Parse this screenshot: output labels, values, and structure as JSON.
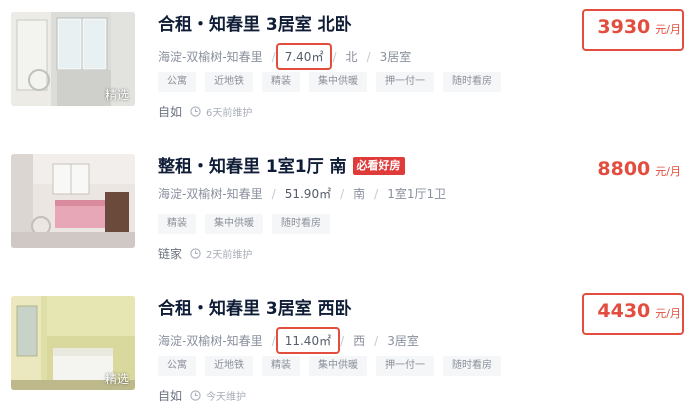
{
  "listings": [
    {
      "title": "合租・知春里 3居室 北卧",
      "promo_badge": "",
      "thumb_badge": "精选",
      "location": "海淀-双榆树-知春里",
      "area": "7.40㎡",
      "orientation": "北",
      "layout": "3居室",
      "tags": [
        "公寓",
        "近地铁",
        "精装",
        "集中供暖",
        "押一付一",
        "随时看房"
      ],
      "brand": "自如",
      "updated": "6天前维护",
      "price": "3930",
      "price_unit": "元/月"
    },
    {
      "title": "整租・知春里 1室1厅 南",
      "promo_badge": "必看好房",
      "thumb_badge": "",
      "location": "海淀-双榆树-知春里",
      "area": "51.90㎡",
      "orientation": "南",
      "layout": "1室1厅1卫",
      "tags": [
        "精装",
        "集中供暖",
        "随时看房"
      ],
      "brand": "链家",
      "updated": "2天前维护",
      "price": "8800",
      "price_unit": "元/月"
    },
    {
      "title": "合租・知春里 3居室 西卧",
      "promo_badge": "",
      "thumb_badge": "精选",
      "location": "海淀-双榆树-知春里",
      "area": "11.40㎡",
      "orientation": "西",
      "layout": "3居室",
      "tags": [
        "公寓",
        "近地铁",
        "精装",
        "集中供暖",
        "押一付一",
        "随时看房"
      ],
      "brand": "自如",
      "updated": "今天维护",
      "price": "4430",
      "price_unit": "元/月"
    }
  ],
  "icons": {
    "clock": "clock-icon"
  },
  "colors": {
    "price": "#e24d3d",
    "highlight_box": "#e24d3d",
    "promo_badge": "#e03b3b"
  }
}
